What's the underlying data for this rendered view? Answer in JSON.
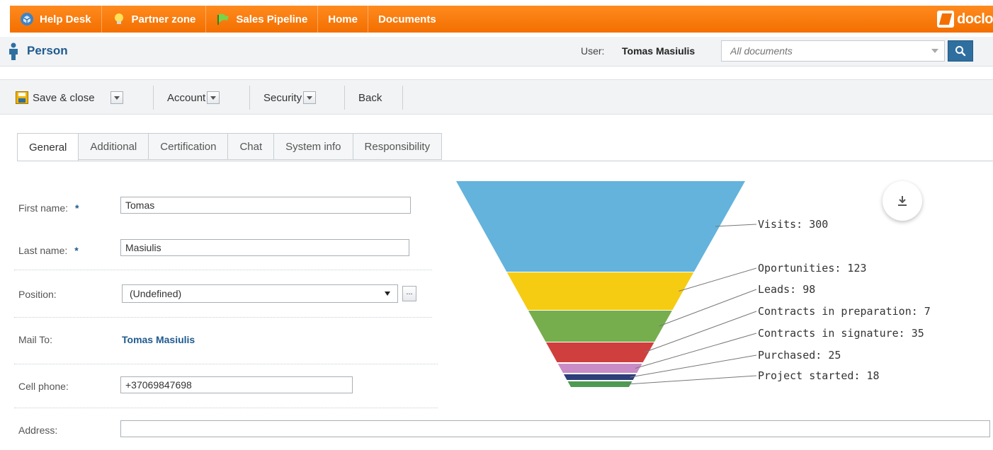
{
  "nav": {
    "items": [
      {
        "label": "Help Desk",
        "icon": "helpdesk-cube-icon"
      },
      {
        "label": "Partner zone",
        "icon": "lightbulb-icon"
      },
      {
        "label": "Sales Pipeline",
        "icon": "flag-icon"
      },
      {
        "label": "Home",
        "icon": ""
      },
      {
        "label": "Documents",
        "icon": ""
      }
    ],
    "logo_text": "doclo"
  },
  "header": {
    "title": "Person",
    "user_label": "User:",
    "user_name": "Tomas Masiulis",
    "search_placeholder": "All documents"
  },
  "toolbar": {
    "save_label": "Save & close",
    "account_label": "Account",
    "security_label": "Security",
    "back_label": "Back"
  },
  "tabs": [
    "General",
    "Additional",
    "Certification",
    "Chat",
    "System info",
    "Responsibility"
  ],
  "active_tab": "General",
  "form": {
    "first_name_label": "First name:",
    "first_name_value": "Tomas",
    "last_name_label": "Last name:",
    "last_name_value": "Masiulis",
    "required_mark": "*",
    "position_label": "Position:",
    "position_value": "(Undefined)",
    "more_button": "...",
    "mail_to_label": "Mail To:",
    "mail_to_value": "Tomas Masiulis",
    "cell_phone_label": "Cell phone:",
    "cell_phone_value": "+37069847698",
    "address_label": "Address:",
    "address_value": ""
  },
  "chart_data": {
    "type": "funnel",
    "categories": [
      "Visits",
      "Oportunities",
      "Leads",
      "Contracts in preparation",
      "Contracts in signature",
      "Purchased",
      "Project started"
    ],
    "values": [
      300,
      123,
      98,
      7,
      35,
      25,
      18
    ],
    "labels": [
      "Visits: 300",
      "Oportunities: 123",
      "Leads: 98",
      "Contracts in preparation: 7",
      "Contracts in signature: 35",
      "Purchased: 25",
      "Project started: 18"
    ],
    "colors": [
      "#63b3dc",
      "#f5cc12",
      "#76ae4d",
      "#cf3f3d",
      "#c98cc6",
      "#2d3e78",
      "#4f9a52"
    ],
    "title": "",
    "legend": "none"
  },
  "colors": {
    "accent": "#f36f00",
    "link": "#1f5a8e",
    "search_button": "#2f6f9f"
  }
}
